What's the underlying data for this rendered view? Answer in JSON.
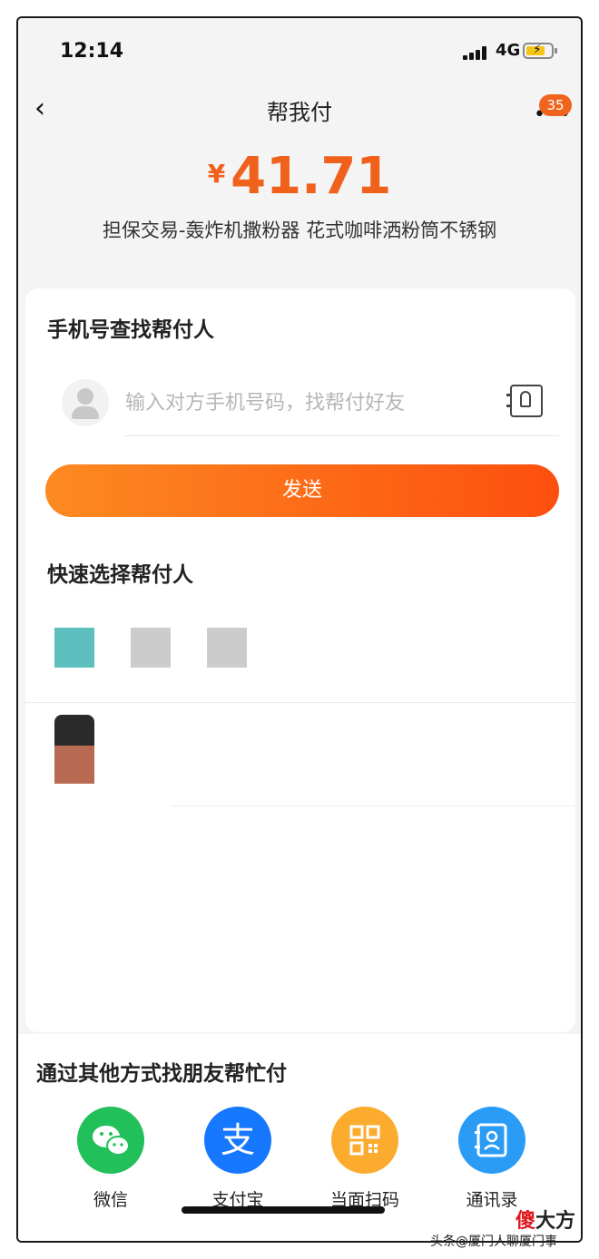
{
  "status": {
    "time": "12:14",
    "network": "4G"
  },
  "nav": {
    "back_glyph": "‹",
    "title": "帮我付",
    "more_glyph": "•••",
    "badge": "35"
  },
  "amount": {
    "currency": "¥",
    "value": "41.71"
  },
  "description": "担保交易-轰炸机撒粉器 花式咖啡洒粉筒不锈钢",
  "phone_search": {
    "title": "手机号查找帮付人",
    "placeholder": "输入对方手机号码，找帮付好友",
    "send_label": "发送"
  },
  "quick_select": {
    "title": "快速选择帮付人",
    "swatch_colors": [
      "#5ebfbf",
      "#cccccc",
      "#cccccc"
    ]
  },
  "other_ways": {
    "title": "通过其他方式找朋友帮忙付",
    "options": [
      {
        "label": "微信",
        "icon": "wechat-icon",
        "color": "#22c05a"
      },
      {
        "label": "支付宝",
        "icon": "alipay-icon",
        "color": "#1677ff"
      },
      {
        "label": "当面扫码",
        "icon": "qr-code-icon",
        "color": "#fbab2e"
      },
      {
        "label": "通讯录",
        "icon": "contacts-book-icon",
        "color": "#2a9cf6"
      }
    ]
  },
  "watermark": {
    "brand_red": "傻",
    "brand_black": "大方",
    "source": "头条@厦门人聊厦门事"
  }
}
